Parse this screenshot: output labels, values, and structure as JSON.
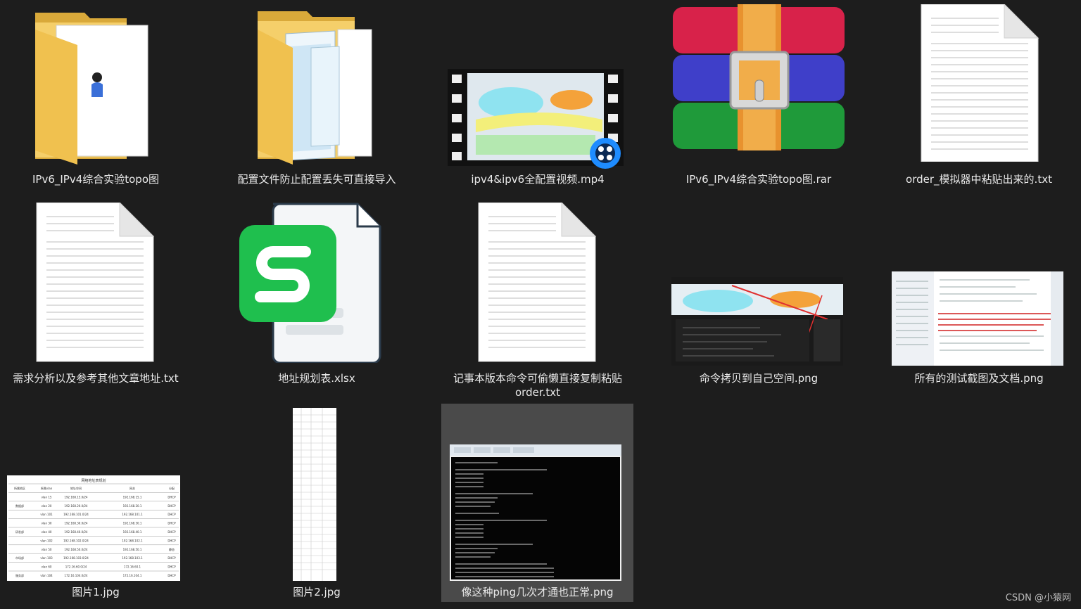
{
  "files": [
    {
      "name": "IPv6_IPv4综合实验topo图",
      "icon": "folder-icon"
    },
    {
      "name": "配置文件防止配置丢失可直接导入",
      "icon": "folder-icon"
    },
    {
      "name": "ipv4&ipv6全配置视频.mp4",
      "icon": "video-file-icon"
    },
    {
      "name": "IPv6_IPv4综合实验topo图.rar",
      "icon": "archive-icon"
    },
    {
      "name": "order_模拟器中粘贴出来的.txt",
      "icon": "text-file-icon"
    },
    {
      "name": "需求分析以及参考其他文章地址.txt",
      "icon": "text-file-icon"
    },
    {
      "name": "地址规划表.xlsx",
      "icon": "spreadsheet-icon"
    },
    {
      "name": "记事本版本命令可偷懒直接复制粘贴\norder.txt",
      "icon": "text-file-icon"
    },
    {
      "name": "命令拷贝到自己空间.png",
      "icon": "image-file-icon"
    },
    {
      "name": "所有的测试截图及文档.png",
      "icon": "image-file-icon"
    },
    {
      "name": "图片1.jpg",
      "icon": "image-file-icon"
    },
    {
      "name": "图片2.jpg",
      "icon": "image-file-icon"
    },
    {
      "name": "像这种ping几次才通也正常.png",
      "icon": "image-file-icon"
    }
  ],
  "table_preview": {
    "title": "网络地址表规划",
    "headers": [
      "所属地区",
      "所属vlan",
      "地址空间",
      "网关",
      "分配"
    ],
    "rows": [
      [
        "",
        "vlan 15",
        "192.168.15.0/24",
        "192.168.15.1",
        "DHCP"
      ],
      [
        "数据部",
        "vlan 20",
        "192.168.20.0/24",
        "192.168.20.1",
        "DHCP"
      ],
      [
        "",
        "vlan 101",
        "192.168.101.0/24",
        "192.168.101.1",
        "DHCP"
      ],
      [
        "",
        "vlan 30",
        "192.168.30.0/24",
        "192.168.30.1",
        "DHCP"
      ],
      [
        "研发部",
        "vlan 40",
        "192.168.40.0/24",
        "192.168.40.1",
        "DHCP"
      ],
      [
        "",
        "vlan 102",
        "192.168.102.0/24",
        "192.168.102.1",
        "DHCP"
      ],
      [
        "",
        "vlan 50",
        "192.168.50.0/24",
        "192.168.50.1",
        "静态"
      ],
      [
        "市场部",
        "vlan 103",
        "192.168.103.0/24",
        "192.168.103.1",
        "DHCP"
      ],
      [
        "",
        "vlan 60",
        "172.16.60.0/24",
        "172.16.60.1",
        "DHCP"
      ],
      [
        "服务部",
        "vlan 104",
        "172.16.104.0/24",
        "172.16.104.1",
        "DHCP"
      ]
    ]
  },
  "watermark": "CSDN @小猿网",
  "colors": {
    "background": "#1d1d1d",
    "selected": "#4a4a4a",
    "label": "#eaeaea"
  }
}
